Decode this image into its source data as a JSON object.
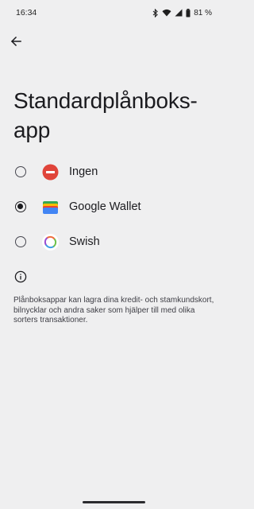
{
  "status_bar": {
    "time": "16:34",
    "battery": "81 %",
    "icons": [
      "bluetooth-icon",
      "wifi-icon",
      "signal-icon",
      "battery-icon"
    ]
  },
  "header": {
    "back_icon": "arrow-back-icon",
    "title": "Standardplånboks-app"
  },
  "options": [
    {
      "label": "Ingen",
      "icon": "no-entry-icon",
      "selected": false
    },
    {
      "label": "Google Wallet",
      "icon": "google-wallet-icon",
      "selected": true
    },
    {
      "label": "Swish",
      "icon": "swish-icon",
      "selected": false
    }
  ],
  "info": {
    "icon": "info-icon",
    "text": "Plånboksappar kan lagra dina kredit- och stamkundskort, bilnycklar och andra saker som hjälper till med olika sorters transaktioner."
  },
  "colors": {
    "background": "#efeff0",
    "no_entry_red": "#e0443a"
  }
}
